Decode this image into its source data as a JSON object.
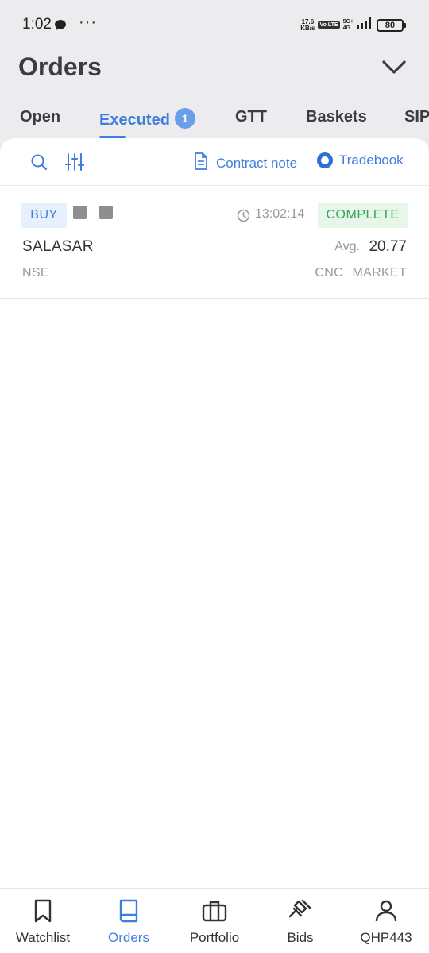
{
  "status_bar": {
    "time": "1:02",
    "more": "···",
    "speed_value": "17.6",
    "speed_unit": "KB/s",
    "volte": "Vo LTE",
    "network_top": "5G+",
    "network_bottom": "4G",
    "battery": "80"
  },
  "header": {
    "title": "Orders"
  },
  "tabs": [
    {
      "label": "Open"
    },
    {
      "label": "Executed",
      "badge": "1"
    },
    {
      "label": "GTT"
    },
    {
      "label": "Baskets"
    },
    {
      "label": "SIP"
    }
  ],
  "toolbar": {
    "contract_note_label": "Contract note",
    "tradebook_label": "Tradebook"
  },
  "orders": [
    {
      "side": "BUY",
      "time": "13:02:14",
      "status": "COMPLETE",
      "symbol": "SALASAR",
      "avg_label": "Avg.",
      "avg_price": "20.77",
      "exchange": "NSE",
      "product": "CNC",
      "order_type": "MARKET"
    }
  ],
  "bottom_nav": [
    {
      "label": "Watchlist",
      "icon": "bookmark-icon"
    },
    {
      "label": "Orders",
      "icon": "book-icon",
      "active": true
    },
    {
      "label": "Portfolio",
      "icon": "briefcase-icon"
    },
    {
      "label": "Bids",
      "icon": "gavel-icon"
    },
    {
      "label": "QHP443",
      "icon": "user-icon"
    }
  ],
  "colors": {
    "accent": "#3f7fdc",
    "complete_green": "#3aa35a",
    "buy_bg": "#e7f1fd",
    "complete_bg": "#e6f6e9"
  }
}
